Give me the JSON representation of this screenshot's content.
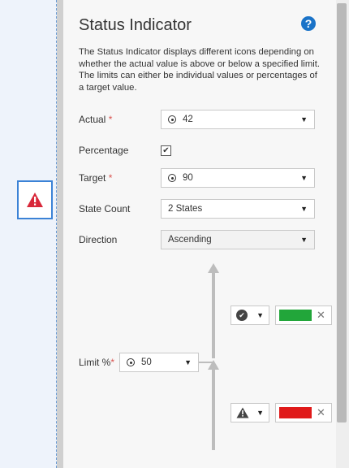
{
  "panel": {
    "title": "Status Indicator",
    "help_icon": "question-circle-icon",
    "help_glyph": "?",
    "description": "The Status Indicator displays different icons depending on whether the actual value is above or below a specified limit. The limits can either be individual values or percentages of a target value."
  },
  "fields": {
    "actual": {
      "label": "Actual",
      "required_mark": "*",
      "value": "42"
    },
    "percentage": {
      "label": "Percentage",
      "checked": true,
      "check_glyph": "✔"
    },
    "target": {
      "label": "Target",
      "required_mark": "*",
      "value": "90"
    },
    "state_count": {
      "label": "State Count",
      "value": "2 States"
    },
    "direction": {
      "label": "Direction",
      "value": "Ascending"
    }
  },
  "limit": {
    "label": "Limit %",
    "required_mark": "*",
    "value": "50"
  },
  "states": [
    {
      "icon": "check-circle-icon",
      "glyph": "✔",
      "color": "#22a63a"
    },
    {
      "icon": "warning-triangle-icon",
      "color": "#e01a1a"
    }
  ],
  "canvas": {
    "widget_icon": "warning-triangle-icon",
    "widget_color": "#d8283a"
  },
  "controls": {
    "caret": "▼",
    "clear": "✕"
  }
}
